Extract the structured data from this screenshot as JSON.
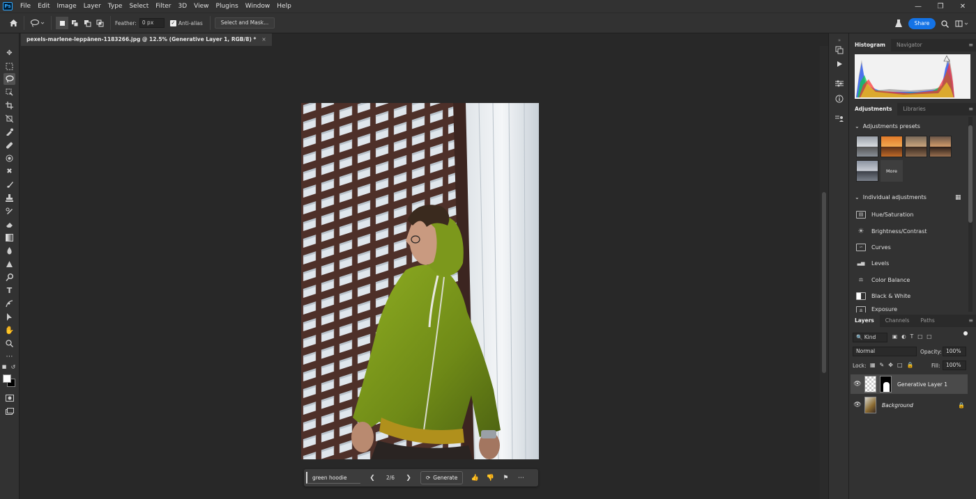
{
  "menu": [
    "File",
    "Edit",
    "Image",
    "Layer",
    "Type",
    "Select",
    "Filter",
    "3D",
    "View",
    "Plugins",
    "Window",
    "Help"
  ],
  "logo": "Ps",
  "options": {
    "feather_label": "Feather:",
    "feather_value": "0 px",
    "antialias_label": "Anti-alias",
    "select_mask_label": "Select and Mask...",
    "share_label": "Share"
  },
  "document_tab": {
    "title": "pexels-marlene-leppänen-1183266.jpg @ 12.5% (Generative Layer 1, RGB/8) *",
    "close": "×"
  },
  "taskbar": {
    "prompt": "green hoodie",
    "counter": "2/6",
    "generate_label": "Generate"
  },
  "histogram_panel": {
    "tabs": [
      "Histogram",
      "Navigator"
    ]
  },
  "adjustments_panel": {
    "tabs": [
      "Adjustments",
      "Libraries"
    ],
    "presets_heading": "Adjustments presets",
    "more_label": "More",
    "individual_heading": "Individual adjustments",
    "items": [
      "Hue/Saturation",
      "Brightness/Contrast",
      "Curves",
      "Levels",
      "Color Balance",
      "Black & White",
      "Exposure"
    ]
  },
  "layers_panel": {
    "tabs": [
      "Layers",
      "Channels",
      "Paths"
    ],
    "kind_label": "Kind",
    "blend_mode": "Normal",
    "opacity_label": "Opacity:",
    "opacity_value": "100%",
    "lock_label": "Lock:",
    "fill_label": "Fill:",
    "fill_value": "100%",
    "layers": [
      {
        "name": "Generative Layer 1",
        "selected": true
      },
      {
        "name": "Background",
        "selected": false,
        "locked": true
      }
    ]
  },
  "colors": {
    "accent": "#1473e6",
    "hoodie": "#7f9a1f",
    "building": "#5a3a32"
  }
}
